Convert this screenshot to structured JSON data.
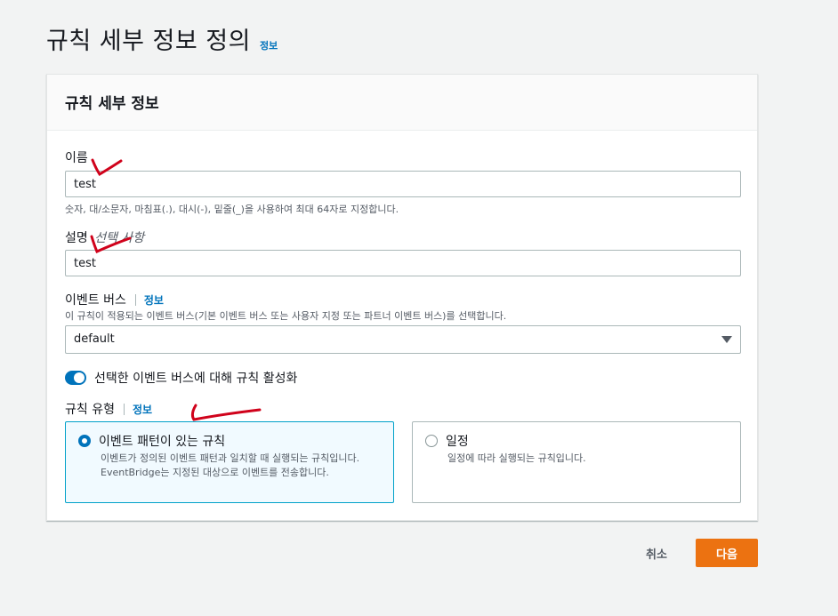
{
  "page": {
    "title": "규칙 세부 정보 정의",
    "info_link": "정보"
  },
  "panel": {
    "title": "규칙 세부 정보"
  },
  "name_field": {
    "label": "이름",
    "value": "test",
    "hint": "숫자, 대/소문자, 마침표(.), 대시(-), 밑줄(_)을 사용하여 최대 64자로 지정합니다."
  },
  "description_field": {
    "label": "설명",
    "optional": "선택 사항",
    "value": "test"
  },
  "event_bus": {
    "label": "이벤트 버스",
    "info_link": "정보",
    "hint": "이 규칙이 적용되는 이벤트 버스(기본 이벤트 버스 또는 사용자 지정 또는 파트너 이벤트 버스)를 선택합니다.",
    "selected": "default"
  },
  "enable_toggle": {
    "label": "선택한 이벤트 버스에 대해 규칙 활성화",
    "on": true
  },
  "rule_type": {
    "label": "규칙 유형",
    "info_link": "정보",
    "options": [
      {
        "title": "이벤트 패턴이 있는 규칙",
        "description": "이벤트가 정의된 이벤트 패턴과 일치할 때 실행되는 규칙입니다. EventBridge는 지정된 대상으로 이벤트를 전송합니다.",
        "selected": true
      },
      {
        "title": "일정",
        "description": "일정에 따라 실행되는 규칙입니다.",
        "selected": false
      }
    ]
  },
  "footer": {
    "cancel_label": "취소",
    "next_label": "다음"
  },
  "colors": {
    "accent": "#0073bb",
    "primary_button": "#ec7211",
    "annotation": "#d0021b"
  }
}
